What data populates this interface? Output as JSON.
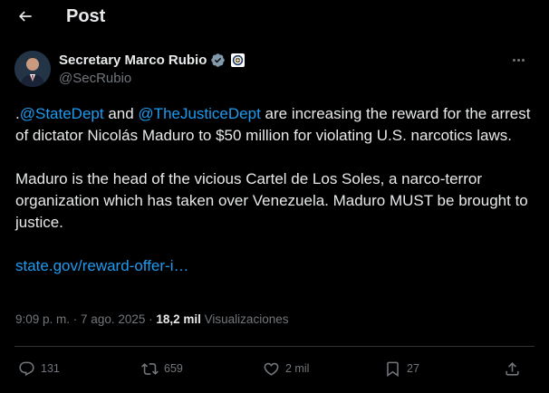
{
  "header": {
    "title": "Post",
    "back_icon": "arrow-left-icon"
  },
  "author": {
    "display_name": "Secretary Marco Rubio",
    "handle": "@SecRubio",
    "verified_icon": "verified-badge-icon",
    "affiliation_icon": "state-department-seal-icon",
    "verified_color": "#1d9bf0"
  },
  "tweet": {
    "lead": ".",
    "mention_1": "@StateDept",
    "and": " and ",
    "mention_2": "@TheJusticeDept",
    "line1_rest": " are increasing the reward for the arrest of dictator Nicolás Maduro to $50 million for violating U.S. narcotics laws.",
    "paragraph_2": "Maduro is the head of the vicious Cartel de Los Soles, a narco-terror organization which has taken over Venezuela. Maduro MUST be brought to justice.",
    "link": "state.gov/reward-offer-i…"
  },
  "meta": {
    "time": "9:09 p. m.",
    "separator": " · ",
    "date": "7 ago. 2025",
    "separator_2": " · ",
    "views_count": "18,2 mil",
    "views_label": " Visualizaciones"
  },
  "actions": {
    "replies": "131",
    "reposts": "659",
    "likes": "2 mil",
    "bookmarks": "27"
  },
  "colors": {
    "background": "#000000",
    "text": "#e7e9ea",
    "muted": "#71767b",
    "accent": "#1d9bf0"
  }
}
